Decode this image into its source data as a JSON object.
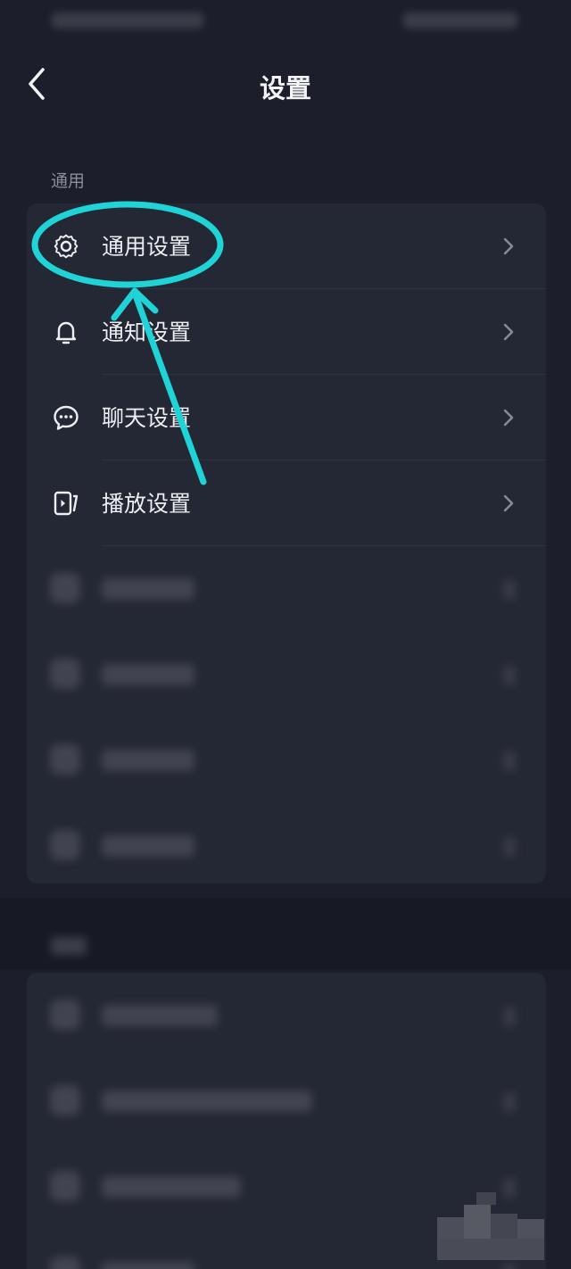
{
  "header": {
    "title": "设置"
  },
  "sections": [
    {
      "label": "通用",
      "items": [
        {
          "label": "通用设置",
          "icon": "gear-icon"
        },
        {
          "label": "通知设置",
          "icon": "bell-icon"
        },
        {
          "label": "聊天设置",
          "icon": "chat-bubble-icon"
        },
        {
          "label": "播放设置",
          "icon": "play-device-icon"
        }
      ],
      "blurred_items_count": 4
    }
  ],
  "colors": {
    "background": "#1c1f2b",
    "card": "#242734",
    "annotation": "#1fd3d6"
  }
}
